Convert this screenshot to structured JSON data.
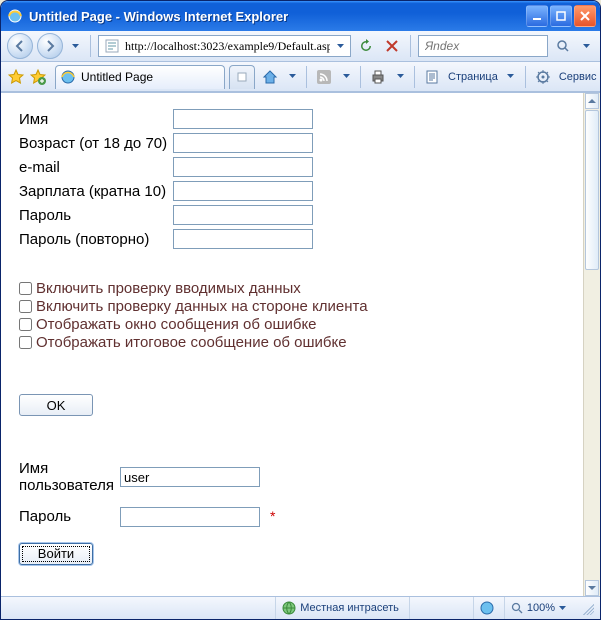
{
  "window": {
    "title": "Untitled Page - Windows Internet Explorer"
  },
  "nav": {
    "url": "http://localhost:3023/example9/Default.aspx",
    "search_placeholder": "Яndex"
  },
  "tabs": {
    "active_label": "Untitled Page"
  },
  "toolbar": {
    "page_label": "Страница",
    "service_label": "Сервис"
  },
  "form1": {
    "rows": [
      {
        "label": "Имя",
        "name": "name",
        "type": "text",
        "value": ""
      },
      {
        "label": "Возраст (от 18 до 70)",
        "name": "age",
        "type": "text",
        "value": ""
      },
      {
        "label": "e-mail",
        "name": "email",
        "type": "text",
        "value": ""
      },
      {
        "label": "Зарплата (кратна 10)",
        "name": "salary",
        "type": "text",
        "value": ""
      },
      {
        "label": "Пароль",
        "name": "password",
        "type": "password",
        "value": ""
      },
      {
        "label": "Пароль (повторно)",
        "name": "password2",
        "type": "password",
        "value": ""
      }
    ],
    "checks": [
      {
        "label": "Включить проверку вводимых данных",
        "checked": false
      },
      {
        "label": "Включить проверку данных на стороне клиента",
        "checked": false
      },
      {
        "label": "Отображать окно сообщения об ошибке",
        "checked": false
      },
      {
        "label": "Отображать итоговое сообщение об ошибке",
        "checked": false
      }
    ],
    "submit_label": "OK"
  },
  "form2": {
    "user_label": "Имя\nпользователя",
    "user_value": "user",
    "pass_label": "Пароль",
    "pass_value": "",
    "required_mark": "*",
    "submit_label": "Войти"
  },
  "status": {
    "zone": "Местная интрасеть",
    "zoom": "100%"
  }
}
